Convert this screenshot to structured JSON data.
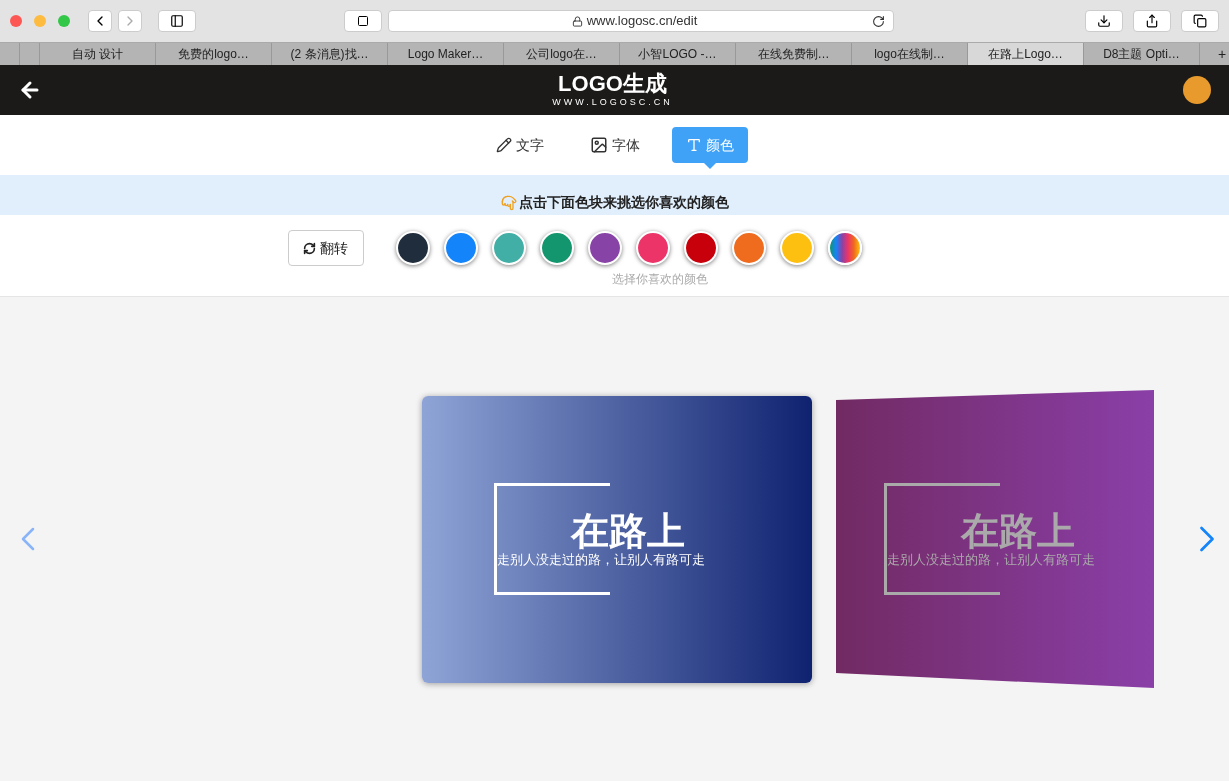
{
  "browser": {
    "url": "www.logosc.cn/edit",
    "tabs": [
      {
        "selected": false
      },
      {
        "selected": false
      },
      {
        "label": "自动 设计",
        "selected": false
      },
      {
        "label": "免费的logo…",
        "selected": false
      },
      {
        "label": "(2 条消息)找…",
        "selected": false
      },
      {
        "label": "Logo Maker…",
        "selected": false
      },
      {
        "label": "公司logo在…",
        "selected": false
      },
      {
        "label": "小智LOGO -…",
        "selected": false
      },
      {
        "label": "在线免费制…",
        "selected": false
      },
      {
        "label": "logo在线制…",
        "selected": false
      },
      {
        "label": "在路上Logo…",
        "selected": true
      },
      {
        "label": "D8主题 Opti…",
        "selected": false
      }
    ],
    "new_tab": "+"
  },
  "header": {
    "logo": "LOGO生成",
    "logo_sub": "WWW.LOGOSC.CN"
  },
  "editor_tabs": [
    {
      "label": "文字",
      "kind": "text",
      "selected": false
    },
    {
      "label": "字体",
      "kind": "font",
      "selected": false
    },
    {
      "label": "颜色",
      "kind": "color",
      "selected": true
    }
  ],
  "hint": "点击下面色块来挑选你喜欢的颜色",
  "flip_button": "翻转",
  "swatches": [
    {
      "kind": "solid",
      "color": "#1f2d3d"
    },
    {
      "kind": "solid",
      "color": "#1484fa"
    },
    {
      "kind": "solid",
      "color": "#41afa5"
    },
    {
      "kind": "solid",
      "color": "#13956e"
    },
    {
      "kind": "solid",
      "color": "#8843a6"
    },
    {
      "kind": "solid",
      "color": "#ec3468"
    },
    {
      "kind": "solid",
      "color": "#c7000b"
    },
    {
      "kind": "solid",
      "color": "#ef6b1d"
    },
    {
      "kind": "solid",
      "color": "#fdc010"
    },
    {
      "kind": "gradient"
    }
  ],
  "swatch_caption": "选择你喜欢的颜色",
  "previews": [
    {
      "selected": true,
      "color": "#0f2270",
      "title": "在路上",
      "slogan": "走别人没走过的路，让别人有路可走"
    },
    {
      "selected": false,
      "color": "#8a3fa8",
      "title": "在路上",
      "slogan": "走别人没走过的路，让别人有路可走"
    }
  ]
}
